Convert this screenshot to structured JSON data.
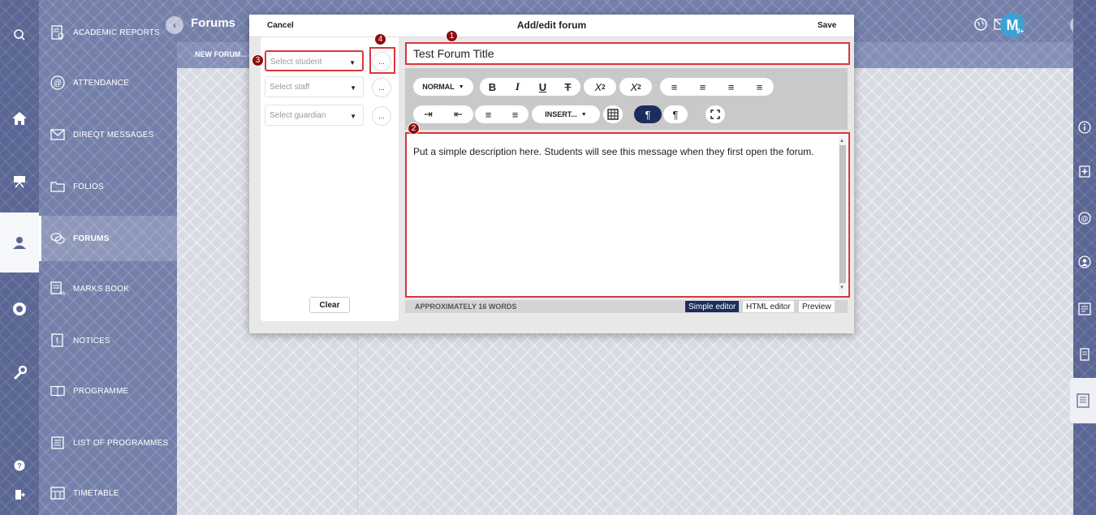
{
  "app": {
    "page_title": "Forums",
    "tab_label": "NEW FORUM..."
  },
  "nav": {
    "items": [
      {
        "label": "ACADEMIC REPORTS",
        "icon": "academic-reports-icon"
      },
      {
        "label": "ATTENDANCE",
        "icon": "at-sign-icon"
      },
      {
        "label": "DIREQT MESSAGES",
        "icon": "envelope-icon"
      },
      {
        "label": "FOLIOS",
        "icon": "folder-icon"
      },
      {
        "label": "FORUMS",
        "icon": "forums-icon"
      },
      {
        "label": "MARKS BOOK",
        "icon": "marks-book-icon"
      },
      {
        "label": "NOTICES",
        "icon": "notice-icon"
      },
      {
        "label": "PROGRAMME",
        "icon": "book-icon"
      },
      {
        "label": "LIST OF PROGRAMMES",
        "icon": "list-icon"
      },
      {
        "label": "TIMETABLE",
        "icon": "timetable-icon"
      }
    ]
  },
  "header": {
    "avatar_letter": "M",
    "badge": "9+"
  },
  "modal": {
    "cancel_label": "Cancel",
    "title": "Add/edit forum",
    "save_label": "Save",
    "select_student_placeholder": "Select student",
    "select_staff_placeholder": "Select staff",
    "select_guardian_placeholder": "Select guardian",
    "more_label": "...",
    "clear_label": "Clear",
    "forum_title_value": "Test Forum Title",
    "format_label": "NORMAL",
    "insert_label": "INSERT...",
    "description": "Put a simple description here. Students will see this message when they first open the forum.",
    "word_count": "APPROXIMATELY 16 WORDS",
    "modes": [
      "Simple editor",
      "HTML editor",
      "Preview"
    ],
    "active_mode": "Simple editor"
  },
  "markers": [
    "1",
    "2",
    "3",
    "4"
  ],
  "colors": {
    "highlight": "#d9373b",
    "marker": "#8b0f0f",
    "nav_bg": "#7480aa",
    "rail_bg": "#5a6694",
    "accent_dark": "#1b2d5a"
  }
}
